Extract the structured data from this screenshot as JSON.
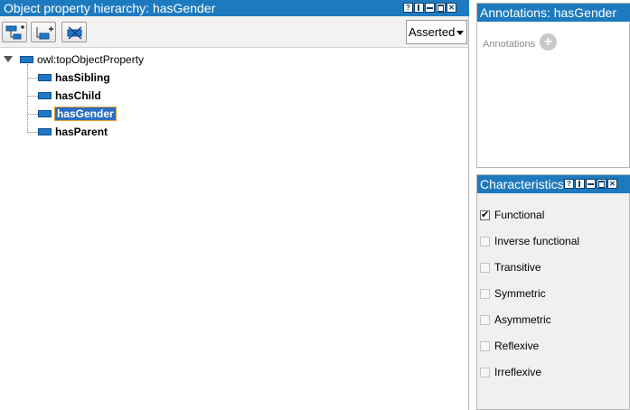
{
  "hierarchy_panel": {
    "title": "Object property hierarchy: hasGender",
    "view_mode": "Asserted",
    "root": "owl:topObjectProperty",
    "children": [
      {
        "label": "hasSibling",
        "selected": false
      },
      {
        "label": "hasChild",
        "selected": false
      },
      {
        "label": "hasGender",
        "selected": true
      },
      {
        "label": "hasParent",
        "selected": false
      }
    ]
  },
  "annotations_panel": {
    "title": "Annotations: hasGender",
    "label": "Annotations",
    "add_icon": "plus-circle-icon"
  },
  "characteristics_panel": {
    "title": "Characteristics",
    "items": [
      {
        "label": "Functional",
        "checked": true
      },
      {
        "label": "Inverse functional",
        "checked": false
      },
      {
        "label": "Transitive",
        "checked": false
      },
      {
        "label": "Symmetric",
        "checked": false
      },
      {
        "label": "Asymmetric",
        "checked": false
      },
      {
        "label": "Reflexive",
        "checked": false
      },
      {
        "label": "Irreflexive",
        "checked": false
      }
    ]
  },
  "colors": {
    "titlebar": "#1e7abf",
    "selection": "#2c6fc2",
    "property_icon": "#1f77c7"
  }
}
